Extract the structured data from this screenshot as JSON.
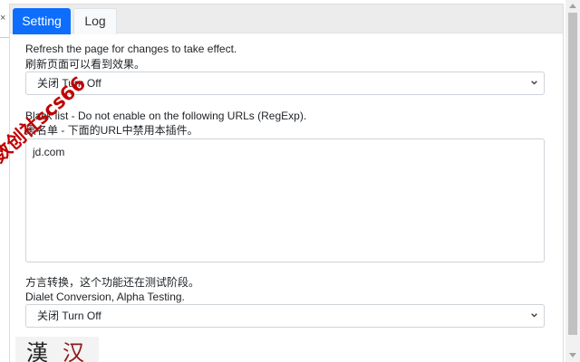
{
  "tabs": [
    {
      "label": "Setting",
      "active": true
    },
    {
      "label": "Log",
      "active": false
    }
  ],
  "colors": {
    "accent": "#0d6efd",
    "watermark": "#c00000"
  },
  "sections": {
    "refresh_note_en": "Refresh the page for changes to take effect.",
    "refresh_note_zh": "刷新页面可以看到效果。",
    "toggle_select": {
      "value": "关闭 Turn Off"
    },
    "blacklist_label_en": "Black list - Do not enable on the following URLs (RegExp).",
    "blacklist_label_zh": "黑名单 - 下面的URL中禁用本插件。",
    "blacklist_value": "jd.com",
    "dialect_label_zh": "方言转换，这个功能还在测试阶段。",
    "dialect_label_en": "Dialet Conversion, Alpha Testing.",
    "dialect_select": {
      "value": "关闭 Turn Off"
    }
  },
  "logo_chars": [
    "漢",
    "汉"
  ],
  "watermark_text": "数创社scs66",
  "icons": {
    "close": "close-icon",
    "dropdown": "chevron-down-icon"
  }
}
